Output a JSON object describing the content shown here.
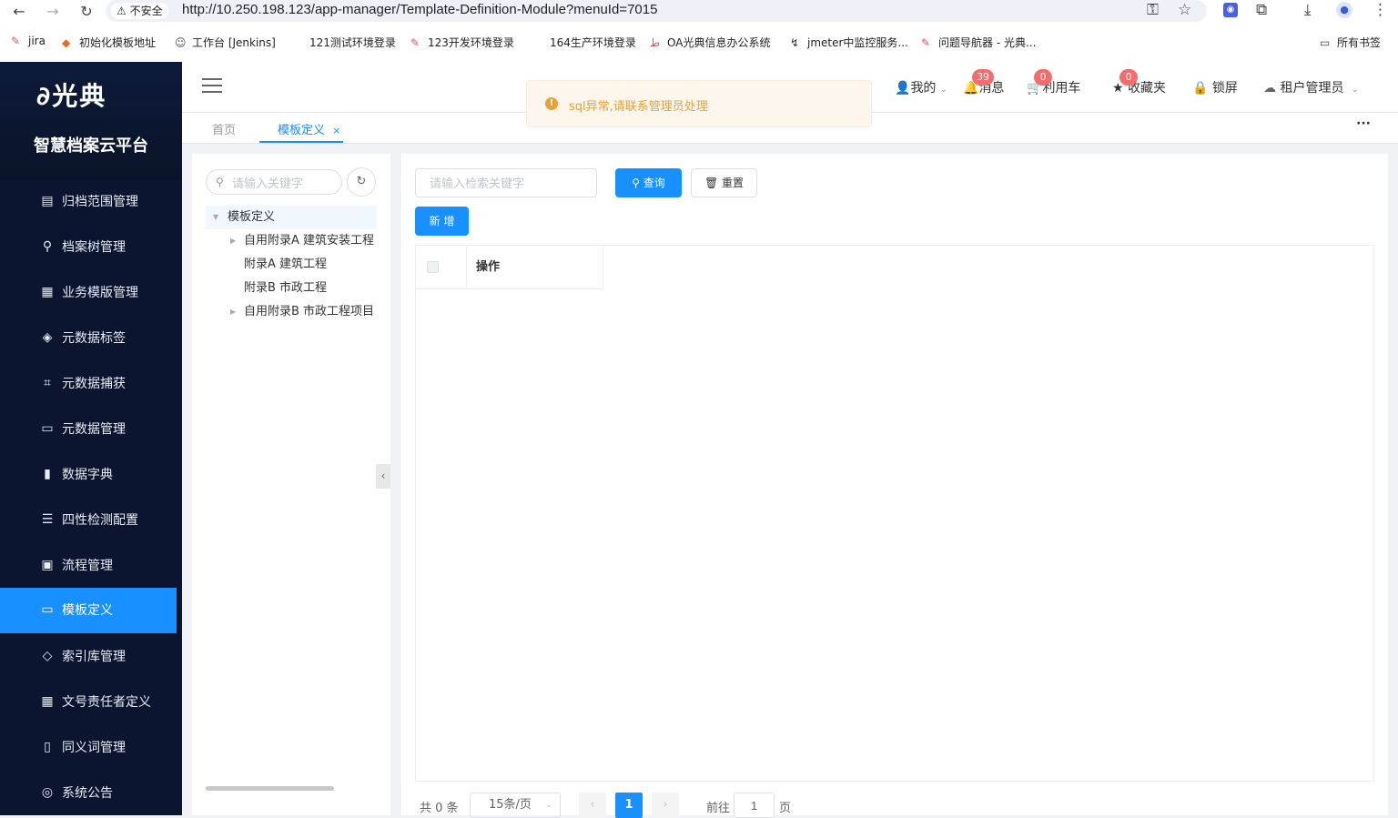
{
  "browser": {
    "insecure_label": "不安全",
    "url": "http://10.250.198.123/app-manager/Template-Definition-Module?menuId=7015",
    "bookmarks": [
      "jira",
      "初始化模板地址",
      "工作台 [Jenkins]",
      "121测试环境登录",
      "123开发环境登录",
      "164生产环境登录",
      "OA光典信息办公系统",
      "jmeter中监控服务...",
      "问题导航器 - 光典...",
      "所有书签"
    ]
  },
  "sidebar": {
    "logo_text": "光典",
    "platform_title": "智慧档案云平台",
    "items": [
      {
        "label": "归档范围管理",
        "icon": "▤"
      },
      {
        "label": "档案树管理",
        "icon": "⚲"
      },
      {
        "label": "业务模版管理",
        "icon": "▦"
      },
      {
        "label": "元数据标签",
        "icon": "◈"
      },
      {
        "label": "元数据捕获",
        "icon": "⌗"
      },
      {
        "label": "元数据管理",
        "icon": "▭"
      },
      {
        "label": "数据字典",
        "icon": "▮"
      },
      {
        "label": "四性检测配置",
        "icon": "☰"
      },
      {
        "label": "流程管理",
        "icon": "▣"
      },
      {
        "label": "模板定义",
        "icon": "▭"
      },
      {
        "label": "索引库管理",
        "icon": "◇"
      },
      {
        "label": "文号责任者定义",
        "icon": "▦"
      },
      {
        "label": "同义词管理",
        "icon": "▯"
      },
      {
        "label": "系统公告",
        "icon": "◎"
      }
    ]
  },
  "header": {
    "mine": "我的",
    "messages": "消息",
    "messages_count": "39",
    "cart": "利用车",
    "cart_count": "0",
    "favorites": "收藏夹",
    "favorites_count": "0",
    "lock": "锁屏",
    "user": "租户管理员"
  },
  "toast": {
    "text": "sql异常,请联系管理员处理"
  },
  "tabs": [
    {
      "label": "首页"
    },
    {
      "label": "模板定义"
    }
  ],
  "tree": {
    "search_placeholder": "请输入关键字",
    "nodes": [
      {
        "label": "模板定义"
      },
      {
        "label": "自用附录A 建筑安装工程"
      },
      {
        "label": "附录A 建筑工程"
      },
      {
        "label": "附录B 市政工程"
      },
      {
        "label": "自用附录B 市政工程项目"
      }
    ]
  },
  "main": {
    "search_placeholder": "请输入检索关键字",
    "query_label": "查询",
    "reset_label": "重置",
    "add_label": "新 增",
    "table_header_op": "操作"
  },
  "pagination": {
    "total": "共 0 条",
    "page_size": "15条/页",
    "current_page": "1",
    "goto_label": "前往",
    "goto_value": "1",
    "page_suffix": "页"
  },
  "colors": {
    "primary": "#1890ff",
    "sidebar_bg": "#0b1530",
    "badge": "#f56c6c",
    "warning": "#e6a23c"
  }
}
